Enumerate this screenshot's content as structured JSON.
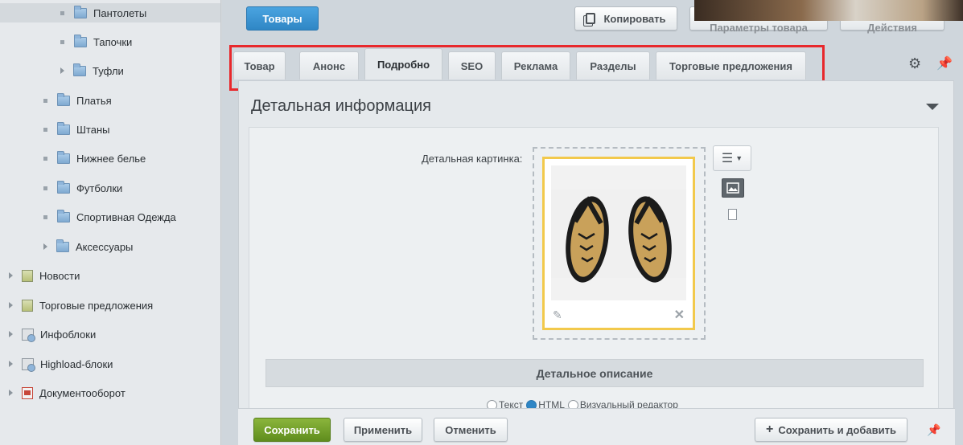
{
  "sidebar": {
    "items": [
      {
        "label": "Пантолеты"
      },
      {
        "label": "Тапочки"
      },
      {
        "label": "Туфли"
      },
      {
        "label": "Платья"
      },
      {
        "label": "Штаны"
      },
      {
        "label": "Нижнее белье"
      },
      {
        "label": "Футболки"
      },
      {
        "label": "Спортивная Одежда"
      },
      {
        "label": "Аксессуары"
      },
      {
        "label": "Новости"
      },
      {
        "label": "Торговые предложения"
      },
      {
        "label": "Инфоблоки"
      },
      {
        "label": "Highload-блоки"
      },
      {
        "label": "Документооборот"
      }
    ]
  },
  "header": {
    "back_label": "Товары",
    "copy_label": "Копировать",
    "product_params_label": "Параметры товара",
    "actions_label": "Действия"
  },
  "tabs": [
    {
      "label": "Товар"
    },
    {
      "label": "Анонс"
    },
    {
      "label": "Подробно"
    },
    {
      "label": "SEO"
    },
    {
      "label": "Реклама"
    },
    {
      "label": "Разделы"
    },
    {
      "label": "Торговые предложения"
    }
  ],
  "active_tab": "Подробно",
  "section": {
    "title": "Детальная информация",
    "picture_label": "Детальная картинка:",
    "description_title": "Детальное описание",
    "editor_modes": [
      "Текст",
      "HTML",
      "Визуальный редактор"
    ],
    "editor_mode_selected": "HTML"
  },
  "footer": {
    "save_label": "Сохранить",
    "apply_label": "Применить",
    "cancel_label": "Отменить",
    "save_add_label": "Сохранить и добавить"
  },
  "colors": {
    "accent": "#2f86c5",
    "save_green": "#6b9a22",
    "highlight_red": "#e8282c",
    "image_border": "#f2c94c"
  },
  "icons": [
    "folder-icon",
    "gear-icon",
    "pin-icon",
    "copy-icon",
    "menu-icon",
    "image-icon",
    "file-icon",
    "pencil-icon",
    "close-icon",
    "plus-icon"
  ]
}
